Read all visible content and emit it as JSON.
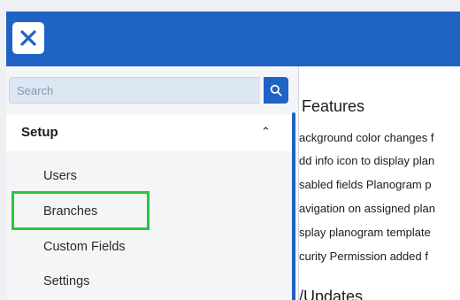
{
  "header": {
    "close_icon": "close-x-icon",
    "colors": {
      "bar": "#1f63c4",
      "highlight": "#2cc53f"
    }
  },
  "sidebar": {
    "search": {
      "placeholder": "Search",
      "value": "",
      "icon": "search-icon"
    },
    "section": {
      "title": "Setup",
      "expanded": true,
      "icon": "chevron-up-icon"
    },
    "items": [
      {
        "label": "Users"
      },
      {
        "label": "Branches",
        "highlighted": true
      },
      {
        "label": "Custom Fields"
      },
      {
        "label": "Settings"
      }
    ]
  },
  "content": {
    "features_title": "Features",
    "features": [
      "ackground color changes f",
      "dd info icon to display plan",
      "sabled fields Planogram p",
      "avigation on assigned plan",
      "splay planogram template",
      "curity Permission added f"
    ],
    "updates_title": "/Updates"
  }
}
